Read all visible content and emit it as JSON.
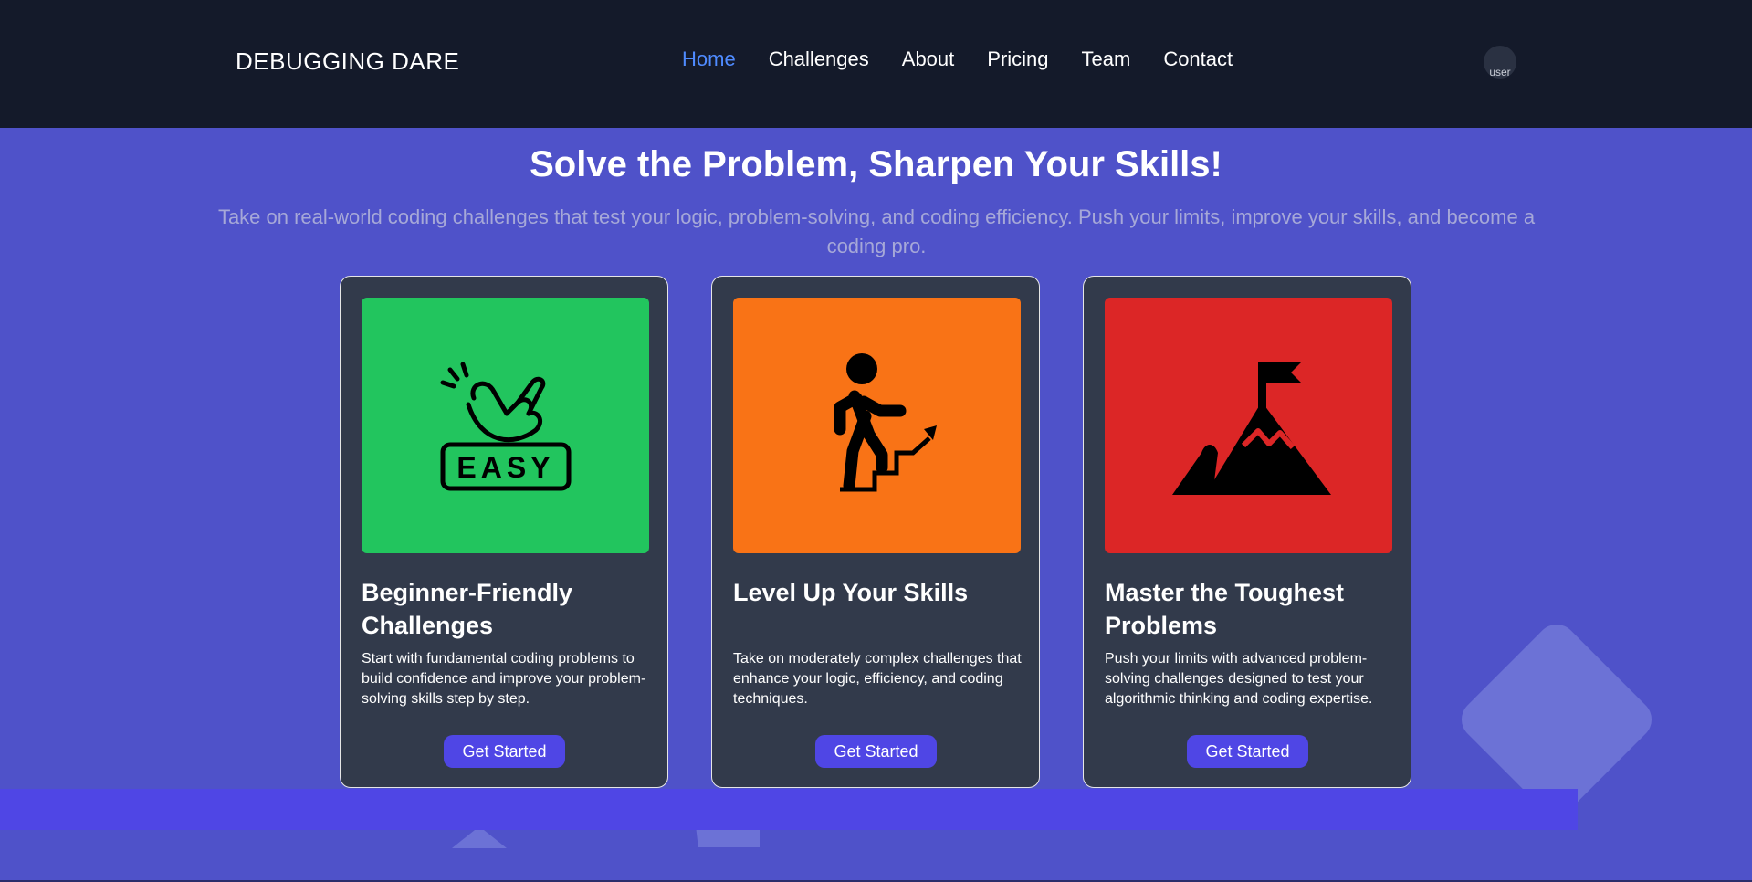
{
  "header": {
    "brand": "DEBUGGING DARE",
    "nav": [
      {
        "label": "Home",
        "active": true
      },
      {
        "label": "Challenges",
        "active": false
      },
      {
        "label": "About",
        "active": false
      },
      {
        "label": "Pricing",
        "active": false
      },
      {
        "label": "Team",
        "active": false
      },
      {
        "label": "Contact",
        "active": false
      }
    ],
    "avatar_alt": "user"
  },
  "hero": {
    "title": "Solve the Problem, Sharpen Your Skills!",
    "subtitle": "Take on real-world coding challenges that test your logic, problem-solving, and coding efficiency. Push your limits, improve your skills, and become a coding pro."
  },
  "cards": [
    {
      "title": "Beginner-Friendly Challenges",
      "description": "Start with fundamental coding problems to build confidence and improve your problem-solving skills step by step.",
      "button": "Get Started",
      "image_color": "#22c55e",
      "icon": "easy-hand-icon",
      "icon_text": "EASY"
    },
    {
      "title": "Level Up Your Skills",
      "description": "Take on moderately complex challenges that enhance your logic, efficiency, and coding techniques.",
      "button": "Get Started",
      "image_color": "#f97316",
      "icon": "climbing-stairs-icon"
    },
    {
      "title": "Master the Toughest Problems",
      "description": "Push your limits with advanced problem-solving challenges designed to test your algorithmic thinking and coding expertise.",
      "button": "Get Started",
      "image_color": "#dc2626",
      "icon": "mountain-flag-icon"
    }
  ],
  "colors": {
    "background": "#4f52c9",
    "navbar": "#141a2a",
    "nav_active": "#4f8bff",
    "card": "#323a4b",
    "button": "#4f46e5"
  }
}
